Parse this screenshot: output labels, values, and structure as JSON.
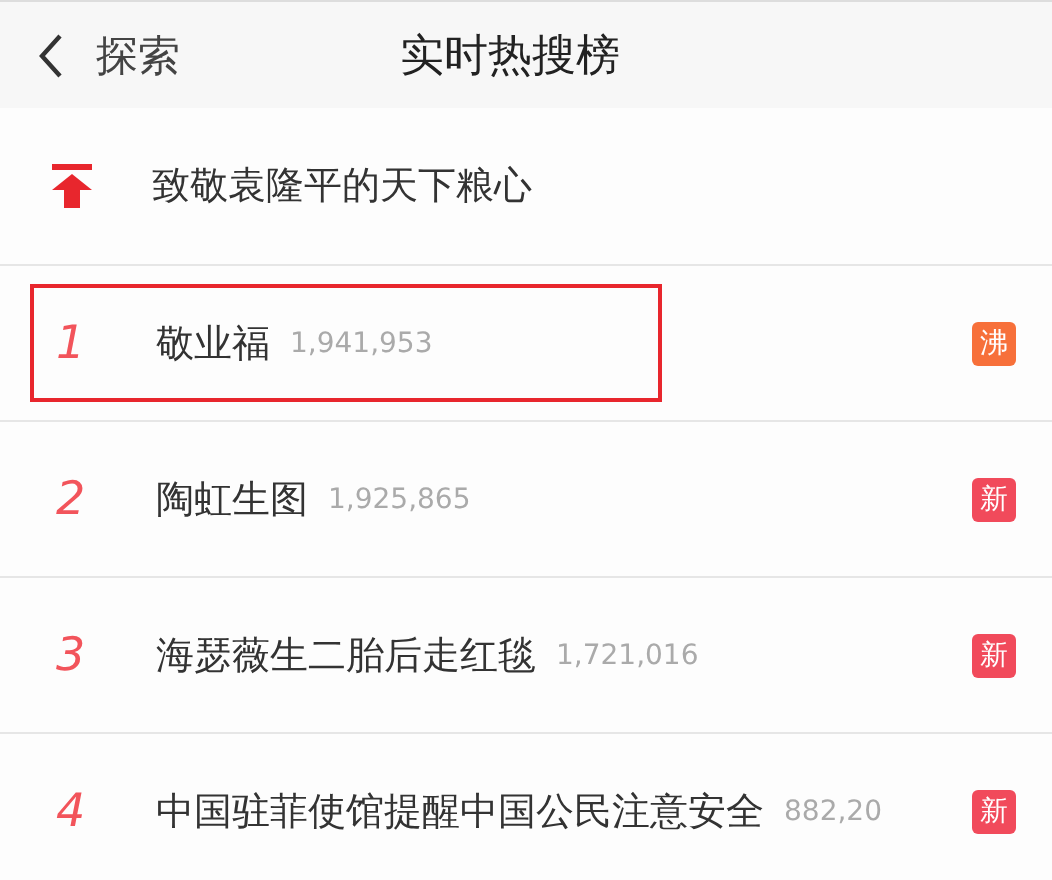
{
  "header": {
    "back_label": "探索",
    "title": "实时热搜榜"
  },
  "pinned": {
    "title": "致敬袁隆平的天下粮心"
  },
  "rows": [
    {
      "rank": "1",
      "title": "敬业福",
      "count": "1,941,953",
      "badge": "沸",
      "color": "#f7703a",
      "highlighted": true
    },
    {
      "rank": "2",
      "title": "陶虹生图",
      "count": "1,925,865",
      "badge": "新",
      "color": "#f14a5b",
      "highlighted": false
    },
    {
      "rank": "3",
      "title": "海瑟薇生二胎后走红毯",
      "count": "1,721,016",
      "badge": "新",
      "color": "#f14a5b",
      "highlighted": false
    },
    {
      "rank": "4",
      "title": "中国驻菲使馆提醒中国公民注意安全",
      "count": "882,20",
      "badge": "新",
      "color": "#f14a5b",
      "highlighted": false
    }
  ]
}
